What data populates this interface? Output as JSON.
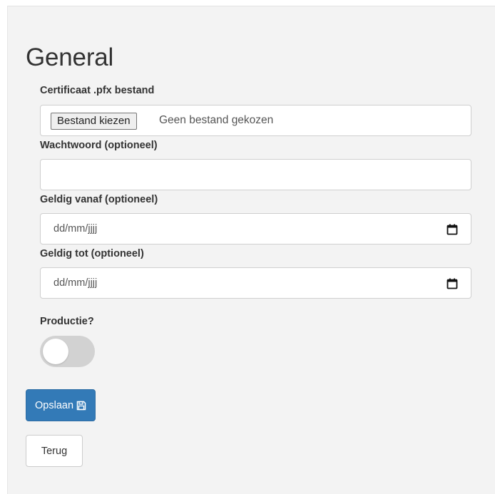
{
  "section": {
    "title": "General"
  },
  "certificate": {
    "label": "Certificaat .pfx bestand",
    "button_label": "Bestand kiezen",
    "status_text": "Geen bestand gekozen"
  },
  "password": {
    "label": "Wachtwoord (optioneel)",
    "value": ""
  },
  "valid_from": {
    "label": "Geldig vanaf (optioneel)",
    "placeholder": "dd/mm/jjjj",
    "icon": "calendar-icon"
  },
  "valid_to": {
    "label": "Geldig tot (optioneel)",
    "placeholder": "dd/mm/jjjj",
    "icon": "calendar-icon"
  },
  "production": {
    "label": "Productie?",
    "enabled": false
  },
  "actions": {
    "save_label": "Opslaan",
    "save_icon": "floppy-disk-icon",
    "back_label": "Terug"
  },
  "colors": {
    "primary": "#337ab7",
    "panel_bg": "#f3f3f3",
    "toggle_off": "#d2d2d2"
  }
}
